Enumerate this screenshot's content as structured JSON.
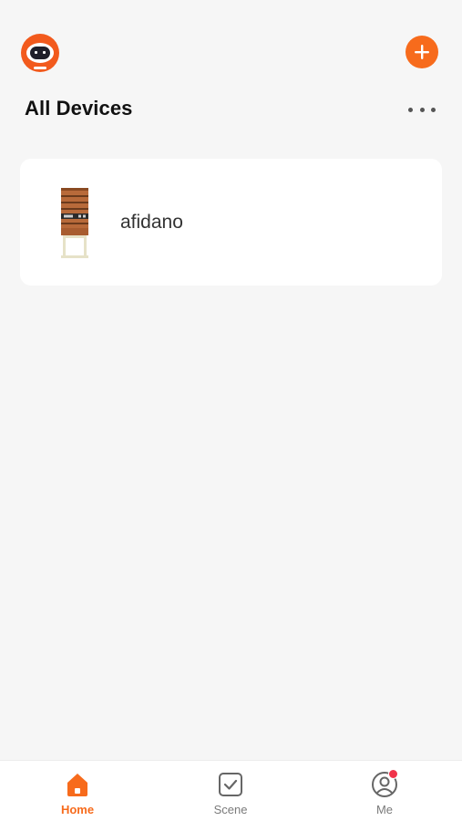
{
  "header": {
    "avatar_icon": "robot-avatar-icon",
    "add_icon": "plus-icon",
    "title": "All Devices",
    "more_icon": "ellipsis-icon"
  },
  "devices": [
    {
      "name": "afidano",
      "icon": "rack-device-icon"
    }
  ],
  "tabbar": {
    "tabs": [
      {
        "label": "Home",
        "icon": "home-icon",
        "active": true
      },
      {
        "label": "Scene",
        "icon": "scene-checkbox-icon",
        "active": false
      },
      {
        "label": "Me",
        "icon": "user-profile-icon",
        "active": false,
        "badge": true
      }
    ]
  },
  "colors": {
    "accent": "#f76b1c",
    "badge": "#f0334a",
    "background": "#f6f6f6"
  }
}
